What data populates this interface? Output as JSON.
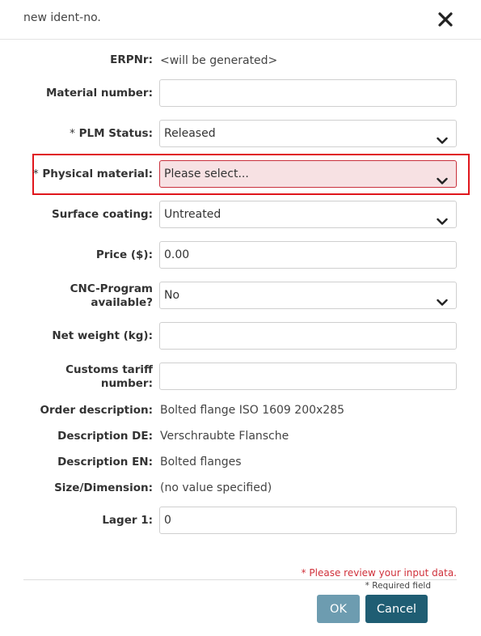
{
  "dialog": {
    "title": "new ident-no.",
    "close_icon": "close-icon"
  },
  "form": {
    "erpnr": {
      "label": "ERPNr:",
      "value": "<will be generated>"
    },
    "material_number": {
      "label": "Material number:",
      "value": ""
    },
    "plm_status": {
      "required_mark": "*",
      "label": "PLM Status:",
      "value": "Released"
    },
    "physical_material": {
      "required_mark": "*",
      "label": "Physical material:",
      "value": "Please select..."
    },
    "surface_coating": {
      "label": "Surface coating:",
      "value": "Untreated"
    },
    "price": {
      "label": "Price ($):",
      "value": "0.00"
    },
    "cnc_program": {
      "label": "CNC-Program available?",
      "value": "No"
    },
    "net_weight": {
      "label": "Net weight (kg):",
      "value": ""
    },
    "customs_tariff": {
      "label": "Customs tariff number:",
      "value": ""
    },
    "order_description": {
      "label": "Order description:",
      "value": "Bolted flange ISO 1609 200x285"
    },
    "description_de": {
      "label": "Description DE:",
      "value": "Verschraubte Flansche"
    },
    "description_en": {
      "label": "Description EN:",
      "value": "Bolted flanges"
    },
    "size_dimension": {
      "label": "Size/Dimension:",
      "value": "(no value specified)"
    },
    "lager1": {
      "label": "Lager 1:",
      "value": "0"
    }
  },
  "footer": {
    "error_message": "* Please review your input data.",
    "required_note": "* Required field",
    "ok_label": "OK",
    "cancel_label": "Cancel"
  },
  "colors": {
    "error": "#d0313b",
    "highlight": "#e0161c",
    "ok_button": "#6d9cb0",
    "cancel_button": "#1f5d73"
  }
}
